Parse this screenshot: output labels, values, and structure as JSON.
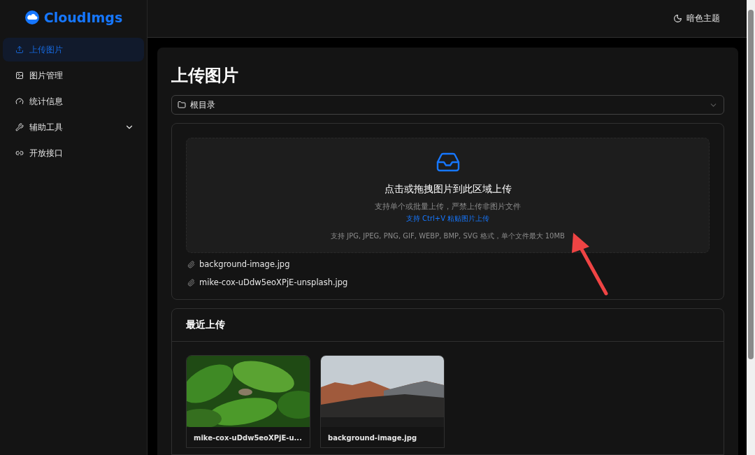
{
  "app": {
    "name": "CloudImgs"
  },
  "sidebar": {
    "items": [
      {
        "label": "上传图片",
        "kind": "link",
        "selected": true
      },
      {
        "label": "图片管理",
        "kind": "link",
        "selected": false
      },
      {
        "label": "统计信息",
        "kind": "link",
        "selected": false
      },
      {
        "label": "辅助工具",
        "kind": "submenu",
        "expanded": false,
        "selected": false
      },
      {
        "label": "开放接口",
        "kind": "link",
        "selected": false
      }
    ]
  },
  "header": {
    "theme_button": "暗色主题"
  },
  "page": {
    "title": "上传图片",
    "folder_select": {
      "value": "根目录"
    },
    "dropzone": {
      "title": "点击或拖拽图片到此区域上传",
      "hint": "支持单个或批量上传，严禁上传非图片文件",
      "paste_hint": "支持 Ctrl+V 粘贴图片上传",
      "formats": "支持 JPG, JPEG, PNG, GIF, WEBP, BMP, SVG 格式，单个文件最大 10MB"
    },
    "files": [
      "background-image.jpg",
      "mike-cox-uDdw5eoXPjE-unsplash.jpg"
    ],
    "recent": {
      "title": "最近上传",
      "items": [
        {
          "kind": "leaves",
          "caption": "mike-cox-uDdw5eoXPjE-u..."
        },
        {
          "kind": "mountain",
          "caption": "background-image.jpg"
        }
      ]
    }
  }
}
